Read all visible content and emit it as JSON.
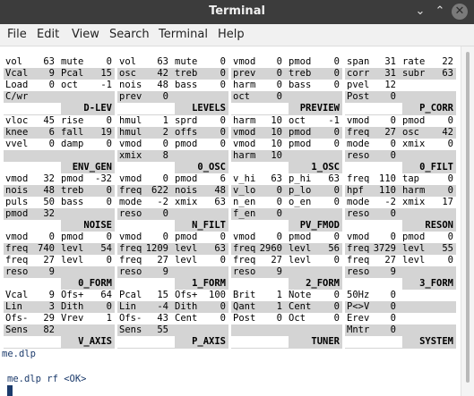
{
  "window": {
    "title": "Terminal",
    "minimize_glyph": "⌄",
    "maximize_glyph": "⌃",
    "close_glyph": "✕"
  },
  "menubar": [
    "File",
    "Edit",
    "View",
    "Search",
    "Terminal",
    "Help"
  ],
  "panels": [
    [
      {
        "title": "D-LEV",
        "rows": [
          [
            "vol",
            "63",
            "mute",
            "0"
          ],
          [
            "Vcal",
            "9",
            "Pcal",
            "15"
          ],
          [
            "Load",
            "0",
            "oct",
            "-1"
          ],
          [
            "C/wr",
            "",
            "",
            ""
          ]
        ]
      },
      {
        "title": "LEVELS",
        "rows": [
          [
            "vol",
            "63",
            "mute",
            "0"
          ],
          [
            "osc",
            "42",
            "treb",
            "0"
          ],
          [
            "nois",
            "48",
            "bass",
            "0"
          ],
          [
            "prev",
            "0",
            "",
            ""
          ]
        ]
      },
      {
        "title": "PREVIEW",
        "rows": [
          [
            "vmod",
            "0",
            "pmod",
            "0"
          ],
          [
            "prev",
            "0",
            "treb",
            "0"
          ],
          [
            "harm",
            "0",
            "bass",
            "0"
          ],
          [
            "oct",
            "0",
            "",
            ""
          ]
        ]
      },
      {
        "title": "P_CORR",
        "rows": [
          [
            "span",
            "31",
            "rate",
            "22"
          ],
          [
            "corr",
            "31",
            "subr",
            "63"
          ],
          [
            "pvel",
            "12",
            "",
            ""
          ],
          [
            "Post",
            "0",
            "",
            ""
          ]
        ]
      }
    ],
    [
      {
        "title": "ENV_GEN",
        "rows": [
          [
            "vloc",
            "45",
            "rise",
            "0"
          ],
          [
            "knee",
            "6",
            "fall",
            "19"
          ],
          [
            "vvel",
            "0",
            "damp",
            "0"
          ]
        ]
      },
      {
        "title": "0_OSC",
        "rows": [
          [
            "hmul",
            "1",
            "sprd",
            "0"
          ],
          [
            "hmul",
            "2",
            "offs",
            "0"
          ],
          [
            "vmod",
            "0",
            "pmod",
            "0"
          ],
          [
            "xmix",
            "8",
            "",
            ""
          ]
        ]
      },
      {
        "title": "1_OSC",
        "rows": [
          [
            "harm",
            "10",
            "oct",
            "-1"
          ],
          [
            "vmod",
            "10",
            "pmod",
            "0"
          ],
          [
            "vmod",
            "10",
            "pmod",
            "0"
          ],
          [
            "harm",
            "10",
            "",
            ""
          ]
        ]
      },
      {
        "title": "0_FILT",
        "rows": [
          [
            "vmod",
            "0",
            "pmod",
            "0"
          ],
          [
            "freq",
            "27",
            "osc",
            "42"
          ],
          [
            "mode",
            "0",
            "xmix",
            "0"
          ],
          [
            "reso",
            "0",
            "",
            ""
          ]
        ]
      }
    ],
    [
      {
        "title": "NOISE",
        "rows": [
          [
            "vmod",
            "32",
            "pmod",
            "-32"
          ],
          [
            "nois",
            "48",
            "treb",
            "0"
          ],
          [
            "puls",
            "50",
            "bass",
            "0"
          ],
          [
            "pmod",
            "32",
            "",
            ""
          ]
        ]
      },
      {
        "title": "N_FILT",
        "rows": [
          [
            "vmod",
            "0",
            "pmod",
            "6"
          ],
          [
            "freq",
            "622",
            "nois",
            "48"
          ],
          [
            "mode",
            "-2",
            "xmix",
            "63"
          ],
          [
            "reso",
            "0",
            "",
            ""
          ]
        ]
      },
      {
        "title": "PV_FMOD",
        "rows": [
          [
            "v_hi",
            "63",
            "p_hi",
            "63"
          ],
          [
            "v_lo",
            "0",
            "p_lo",
            "0"
          ],
          [
            "n_en",
            "0",
            "o_en",
            "0"
          ],
          [
            "f_en",
            "0",
            "",
            ""
          ]
        ]
      },
      {
        "title": "RESON",
        "rows": [
          [
            "freq",
            "110",
            "tap",
            "0"
          ],
          [
            "hpf",
            "110",
            "harm",
            "0"
          ],
          [
            "mode",
            "-2",
            "xmix",
            "17"
          ],
          [
            "reso",
            "0",
            "",
            ""
          ]
        ]
      }
    ],
    [
      {
        "title": "0_FORM",
        "rows": [
          [
            "vmod",
            "0",
            "pmod",
            "0"
          ],
          [
            "freq",
            "740",
            "levl",
            "54"
          ],
          [
            "freq",
            "27",
            "levl",
            "0"
          ],
          [
            "reso",
            "9",
            "",
            ""
          ]
        ]
      },
      {
        "title": "1_FORM",
        "rows": [
          [
            "vmod",
            "0",
            "pmod",
            "0"
          ],
          [
            "freq",
            "1209",
            "levl",
            "63"
          ],
          [
            "freq",
            "27",
            "levl",
            "0"
          ],
          [
            "reso",
            "9",
            "",
            ""
          ]
        ]
      },
      {
        "title": "2_FORM",
        "rows": [
          [
            "vmod",
            "0",
            "pmod",
            "0"
          ],
          [
            "freq",
            "2960",
            "levl",
            "56"
          ],
          [
            "freq",
            "27",
            "levl",
            "0"
          ],
          [
            "reso",
            "9",
            "",
            ""
          ]
        ]
      },
      {
        "title": "3_FORM",
        "rows": [
          [
            "vmod",
            "0",
            "pmod",
            "0"
          ],
          [
            "freq",
            "3729",
            "levl",
            "55"
          ],
          [
            "freq",
            "27",
            "levl",
            "0"
          ],
          [
            "reso",
            "9",
            "",
            ""
          ]
        ]
      }
    ],
    [
      {
        "title": "V_AXIS",
        "rows": [
          [
            "Vcal",
            "9",
            "Ofs+",
            "64"
          ],
          [
            "Lin",
            "3",
            "Dith",
            "0"
          ],
          [
            "Ofs-",
            "29",
            "Vrev",
            "1"
          ],
          [
            "Sens",
            "82",
            "",
            ""
          ]
        ]
      },
      {
        "title": "P_AXIS",
        "rows": [
          [
            "Pcal",
            "15",
            "Ofs+",
            "100"
          ],
          [
            "Lin",
            "-4",
            "Dith",
            "0"
          ],
          [
            "Ofs-",
            "43",
            "Cent",
            "0"
          ],
          [
            "Sens",
            "55",
            "",
            ""
          ]
        ]
      },
      {
        "title": "TUNER",
        "rows": [
          [
            "Brit",
            "1",
            "Note",
            "0"
          ],
          [
            "Qant",
            "1",
            "Cent",
            "0"
          ],
          [
            "Post",
            "0",
            "Oct",
            "0"
          ],
          [
            "",
            "",
            "",
            ""
          ]
        ]
      },
      {
        "title": "SYSTEM",
        "rows": [
          [
            "50Hz",
            "0",
            "",
            ""
          ],
          [
            "P<>V",
            "0",
            "",
            ""
          ],
          [
            "Erev",
            "0",
            "",
            ""
          ],
          [
            "Mntr",
            "0",
            "",
            ""
          ]
        ]
      }
    ]
  ],
  "prompt": {
    "line1": "me.dlp",
    "line2": "me.dlp rf <OK>"
  }
}
